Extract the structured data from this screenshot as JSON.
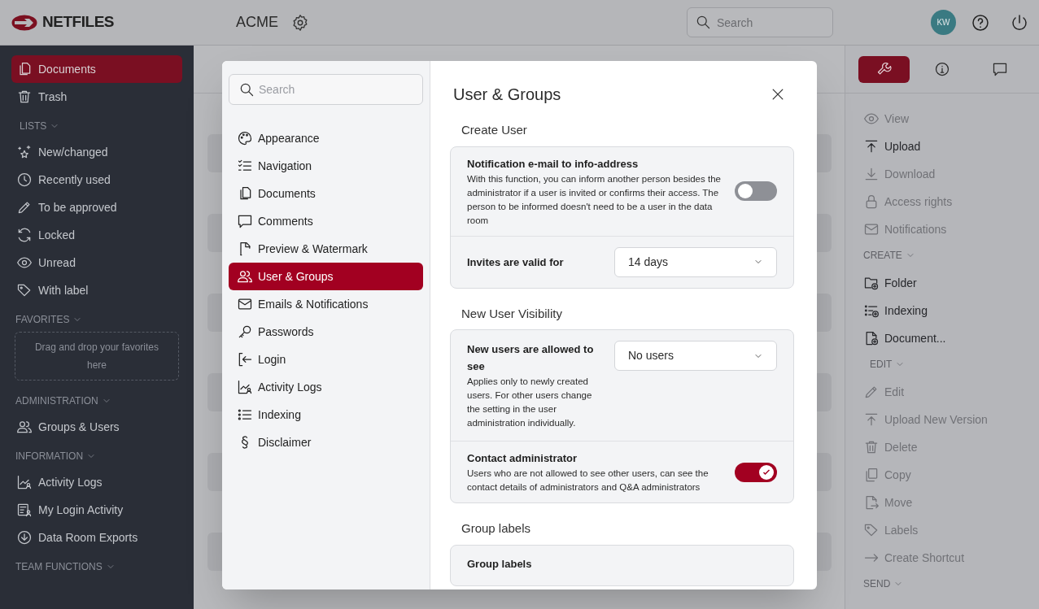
{
  "header": {
    "logo_text": "NETFILES",
    "workspace": "ACME",
    "search": {
      "placeholder": "Search"
    },
    "avatar": "KW"
  },
  "sidebar": {
    "sections": [
      {
        "items": [
          {
            "label": "Documents",
            "selected": true
          },
          {
            "label": "Trash",
            "selected": false
          }
        ]
      },
      {
        "heading": "LISTS",
        "items": [
          {
            "label": "New/changed",
            "selected": false
          },
          {
            "label": "Recently used",
            "selected": false
          },
          {
            "label": "To be approved",
            "selected": false
          },
          {
            "label": "Locked",
            "selected": false
          },
          {
            "label": "Unread",
            "selected": false
          },
          {
            "label": "With label",
            "selected": false
          }
        ]
      },
      {
        "heading": "FAVORITES",
        "dropzone": "Drag and drop your favorites here"
      },
      {
        "heading": "ADMINISTRATION",
        "items": [
          {
            "label": "Groups & Users",
            "selected": false
          }
        ]
      },
      {
        "heading": "INFORMATION",
        "items": [
          {
            "label": "Activity Logs",
            "selected": false
          },
          {
            "label": "My Login Activity",
            "selected": false
          },
          {
            "label": "Data Room Exports",
            "selected": false
          }
        ]
      },
      {
        "heading": "TEAM FUNCTIONS"
      }
    ]
  },
  "actions_panel": {
    "tabs": [
      {
        "selected": true
      },
      {
        "selected": false
      },
      {
        "selected": false
      }
    ],
    "sections": [
      {
        "items": [
          {
            "label": "View",
            "disabled": true
          },
          {
            "label": "Upload",
            "disabled": false
          },
          {
            "label": "Download",
            "disabled": true
          },
          {
            "label": "Access rights",
            "disabled": true
          },
          {
            "label": "Notifications",
            "disabled": true
          }
        ]
      },
      {
        "heading": "CREATE",
        "items": [
          {
            "label": "Folder",
            "disabled": false
          },
          {
            "label": "Indexing",
            "disabled": false
          },
          {
            "label": "Document...",
            "disabled": false
          }
        ]
      },
      {
        "heading": "EDIT",
        "items": [
          {
            "label": "Edit",
            "disabled": true
          },
          {
            "label": "Upload New Version",
            "disabled": true
          },
          {
            "label": "Delete",
            "disabled": true
          },
          {
            "label": "Copy",
            "disabled": true
          },
          {
            "label": "Move",
            "disabled": true
          },
          {
            "label": "Labels",
            "disabled": true
          },
          {
            "label": "Create Shortcut",
            "disabled": true
          }
        ]
      },
      {
        "heading": "SEND"
      }
    ]
  },
  "settings_dialog": {
    "search": {
      "placeholder": "Search"
    },
    "nav": [
      {
        "label": "Appearance",
        "selected": false
      },
      {
        "label": "Navigation",
        "selected": false
      },
      {
        "label": "Documents",
        "selected": false
      },
      {
        "label": "Comments",
        "selected": false
      },
      {
        "label": "Preview & Watermark",
        "selected": false
      },
      {
        "label": "User & Groups",
        "selected": true
      },
      {
        "label": "Emails & Notifications",
        "selected": false
      },
      {
        "label": "Passwords",
        "selected": false
      },
      {
        "label": "Login",
        "selected": false
      },
      {
        "label": "Activity Logs",
        "selected": false
      },
      {
        "label": "Indexing",
        "selected": false
      },
      {
        "label": "Disclaimer",
        "selected": false
      }
    ],
    "title": "User & Groups",
    "sections": [
      {
        "heading": "Create User",
        "rows": [
          {
            "kind": "toggle",
            "label": "Notification e-mail to info-address",
            "description": "With this function, you can inform another person besides the administrator if a user is invited or confirms their access. The person to be informed doesn't need to be a user in the data room",
            "on": false
          },
          {
            "kind": "select",
            "label": "Invites are valid for",
            "value": "14 days"
          }
        ]
      },
      {
        "heading": "New User Visibility",
        "rows": [
          {
            "kind": "select",
            "label": "New users are allowed to see",
            "description": "Applies only to newly created users. For other users change the setting in the user administration individually.",
            "value": "No users"
          },
          {
            "kind": "toggle",
            "label": "Contact administrator",
            "description": "Users who are not allowed to see other users, can see the contact details of administrators and Q&A administrators",
            "on": true
          }
        ]
      },
      {
        "heading": "Group labels",
        "rows": [
          {
            "kind": "text",
            "label": "Group labels"
          }
        ]
      }
    ]
  }
}
